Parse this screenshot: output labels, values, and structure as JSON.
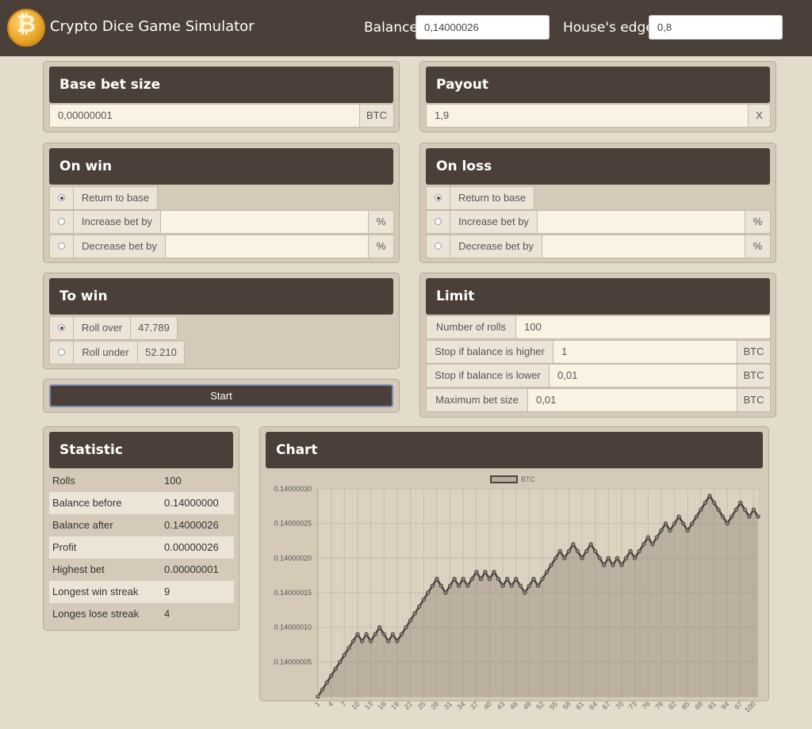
{
  "app": {
    "title": "Crypto Dice Game Simulator",
    "logo_glyph": "₿"
  },
  "header": {
    "balance_label": "Balance:",
    "balance_value": "0,14000026",
    "edge_label": "House's edge:",
    "edge_value": "0,8"
  },
  "base_bet": {
    "title": "Base bet size",
    "value": "0,00000001",
    "unit": "BTC"
  },
  "payout": {
    "title": "Payout",
    "value": "1,9",
    "unit": "X"
  },
  "on_win": {
    "title": "On win",
    "return_label": "Return to base",
    "increase_label": "Increase bet by",
    "increase_value": "",
    "increase_unit": "%",
    "decrease_label": "Decrease bet by",
    "decrease_value": "",
    "decrease_unit": "%"
  },
  "on_loss": {
    "title": "On loss",
    "return_label": "Return to base",
    "increase_label": "Increase bet by",
    "increase_value": "",
    "increase_unit": "%",
    "decrease_label": "Decrease bet by",
    "decrease_value": "",
    "decrease_unit": "%"
  },
  "to_win": {
    "title": "To win",
    "over_label": "Roll over",
    "over_value": "47.789",
    "under_label": "Roll under",
    "under_value": "52.210"
  },
  "start_label": "Start",
  "limit": {
    "title": "Limit",
    "rolls_label": "Number of rolls",
    "rolls_value": "100",
    "higher_label": "Stop if balance is higher",
    "higher_value": "1",
    "higher_unit": "BTC",
    "lower_label": "Stop if balance is lower",
    "lower_value": "0,01",
    "lower_unit": "BTC",
    "max_label": "Maximum bet size",
    "max_value": "0,01",
    "max_unit": "BTC"
  },
  "statistic": {
    "title": "Statistic",
    "rows": [
      {
        "label": "Rolls",
        "value": "100"
      },
      {
        "label": "Balance before",
        "value": "0.14000000"
      },
      {
        "label": "Balance after",
        "value": "0.14000026"
      },
      {
        "label": "Profit",
        "value": "0.00000026"
      },
      {
        "label": "Highest bet",
        "value": "0.00000001"
      },
      {
        "label": "Longest win streak",
        "value": "9"
      },
      {
        "label": "Longes lose streak",
        "value": "4"
      }
    ]
  },
  "chart": {
    "title": "Chart"
  },
  "colors": {
    "header_bg": "#4a3f39",
    "page_bg": "#e4dccb",
    "panel_bg": "#d5cab8",
    "line": "#4a4440"
  },
  "chart_data": {
    "type": "line",
    "series": [
      {
        "name": "BTC",
        "values": [
          0.14,
          0.14000001,
          0.14000002,
          0.14000003,
          0.14000004,
          0.14000005,
          0.14000006,
          0.14000007,
          0.14000008,
          0.14000009,
          0.14000008,
          0.14000009,
          0.14000008,
          0.14000009,
          0.1400001,
          0.14000009,
          0.14000008,
          0.14000009,
          0.14000008,
          0.14000009,
          0.1400001,
          0.14000011,
          0.14000012,
          0.14000013,
          0.14000014,
          0.14000015,
          0.14000016,
          0.14000017,
          0.14000016,
          0.14000015,
          0.14000016,
          0.14000017,
          0.14000016,
          0.14000017,
          0.14000016,
          0.14000017,
          0.14000018,
          0.14000017,
          0.14000018,
          0.14000017,
          0.14000018,
          0.14000017,
          0.14000016,
          0.14000017,
          0.14000016,
          0.14000017,
          0.14000016,
          0.14000015,
          0.14000016,
          0.14000017,
          0.14000016,
          0.14000017,
          0.14000018,
          0.14000019,
          0.1400002,
          0.14000021,
          0.1400002,
          0.14000021,
          0.14000022,
          0.14000021,
          0.1400002,
          0.14000021,
          0.14000022,
          0.14000021,
          0.1400002,
          0.14000019,
          0.1400002,
          0.14000019,
          0.1400002,
          0.14000019,
          0.1400002,
          0.14000021,
          0.1400002,
          0.14000021,
          0.14000022,
          0.14000023,
          0.14000022,
          0.14000023,
          0.14000024,
          0.14000025,
          0.14000024,
          0.14000025,
          0.14000026,
          0.14000025,
          0.14000024,
          0.14000025,
          0.14000026,
          0.14000027,
          0.14000028,
          0.14000029,
          0.14000028,
          0.14000027,
          0.14000026,
          0.14000025,
          0.14000026,
          0.14000027,
          0.14000028,
          0.14000027,
          0.14000026,
          0.14000027,
          0.14000026
        ]
      }
    ],
    "x": [
      1,
      4,
      7,
      10,
      13,
      16,
      19,
      22,
      25,
      28,
      31,
      34,
      37,
      40,
      43,
      46,
      49,
      52,
      55,
      58,
      61,
      64,
      67,
      70,
      73,
      76,
      79,
      82,
      85,
      88,
      91,
      94,
      97,
      100
    ],
    "y_ticks": [
      "0.14000005",
      "0.14000010",
      "0.14000015",
      "0.14000020",
      "0.14000025",
      "0.14000030"
    ],
    "ylim": [
      0.14,
      0.1400003
    ],
    "legend": "top-center",
    "grid": true
  }
}
